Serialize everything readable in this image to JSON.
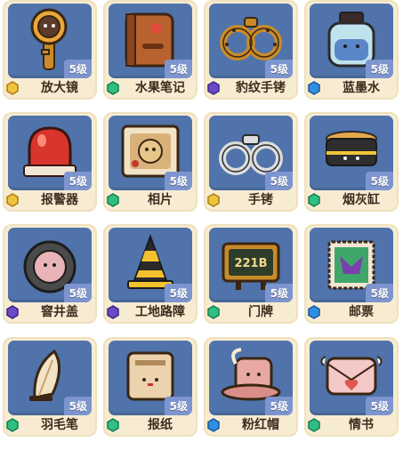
{
  "colors": {
    "tile": "#4f73aa",
    "card": "#f7ecd2",
    "level_badge": "#7d95cf",
    "rarity_gold": "#f0c43a",
    "rarity_green": "#2fbf83",
    "rarity_purple": "#6a49c8",
    "rarity_blue": "#2f8fe0"
  },
  "items": [
    {
      "name": "放大镜",
      "level": "5级",
      "rarity": "gold-hexagon-icon",
      "icon": "magnifier-icon"
    },
    {
      "name": "水果笔记",
      "level": "5级",
      "rarity": "green-hexagon-icon",
      "icon": "fruit-notebook-icon"
    },
    {
      "name": "豹纹手铐",
      "level": "5级",
      "rarity": "purple-hexagon-icon",
      "icon": "leopard-handcuffs-icon"
    },
    {
      "name": "蓝墨水",
      "level": "5级",
      "rarity": "blue-hexagon-icon",
      "icon": "blue-ink-icon"
    },
    {
      "name": "报警器",
      "level": "5级",
      "rarity": "gold-hexagon-icon",
      "icon": "alarm-icon"
    },
    {
      "name": "相片",
      "level": "5级",
      "rarity": "green-hexagon-icon",
      "icon": "photo-icon"
    },
    {
      "name": "手铐",
      "level": "5级",
      "rarity": "gold-hexagon-icon",
      "icon": "handcuffs-icon"
    },
    {
      "name": "烟灰缸",
      "level": "5级",
      "rarity": "green-hexagon-icon",
      "icon": "ashtray-icon"
    },
    {
      "name": "窨井盖",
      "level": "5级",
      "rarity": "purple-hexagon-icon",
      "icon": "manhole-cover-icon"
    },
    {
      "name": "工地路障",
      "level": "5级",
      "rarity": "purple-hexagon-icon",
      "icon": "traffic-cone-icon"
    },
    {
      "name": "门牌",
      "level": "5级",
      "rarity": "green-hexagon-icon",
      "icon": "door-plate-icon"
    },
    {
      "name": "邮票",
      "level": "5级",
      "rarity": "blue-hexagon-icon",
      "icon": "stamp-icon"
    },
    {
      "name": "羽毛笔",
      "level": "5级",
      "rarity": "green-hexagon-icon",
      "icon": "quill-icon"
    },
    {
      "name": "报纸",
      "level": "5级",
      "rarity": "green-hexagon-icon",
      "icon": "newspaper-icon"
    },
    {
      "name": "粉红帽",
      "level": "5级",
      "rarity": "blue-hexagon-icon",
      "icon": "pink-hat-icon"
    },
    {
      "name": "情书",
      "level": "5级",
      "rarity": "green-hexagon-icon",
      "icon": "love-letter-icon"
    }
  ]
}
